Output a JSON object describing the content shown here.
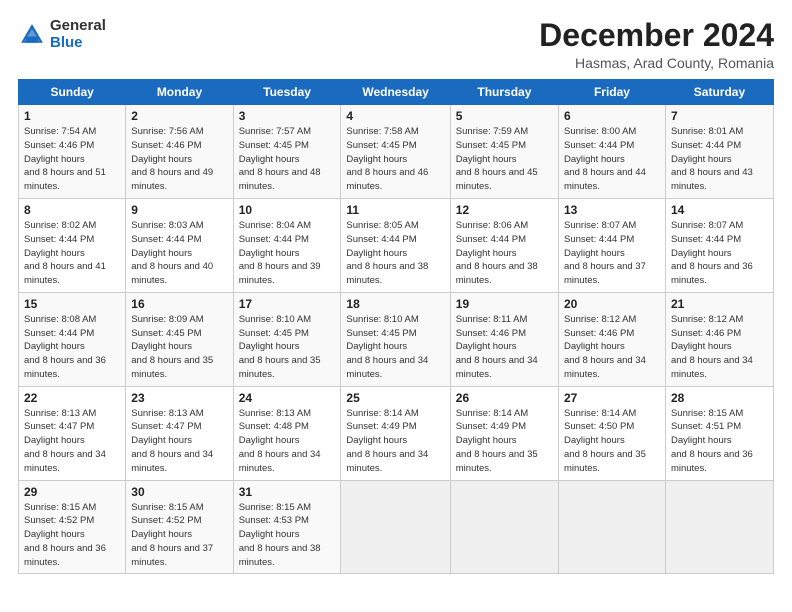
{
  "header": {
    "logo_general": "General",
    "logo_blue": "Blue",
    "title": "December 2024",
    "subtitle": "Hasmas, Arad County, Romania"
  },
  "days_of_week": [
    "Sunday",
    "Monday",
    "Tuesday",
    "Wednesday",
    "Thursday",
    "Friday",
    "Saturday"
  ],
  "weeks": [
    [
      {
        "num": "1",
        "rise": "7:54 AM",
        "set": "4:46 PM",
        "daylight": "8 hours and 51 minutes."
      },
      {
        "num": "2",
        "rise": "7:56 AM",
        "set": "4:46 PM",
        "daylight": "8 hours and 49 minutes."
      },
      {
        "num": "3",
        "rise": "7:57 AM",
        "set": "4:45 PM",
        "daylight": "8 hours and 48 minutes."
      },
      {
        "num": "4",
        "rise": "7:58 AM",
        "set": "4:45 PM",
        "daylight": "8 hours and 46 minutes."
      },
      {
        "num": "5",
        "rise": "7:59 AM",
        "set": "4:45 PM",
        "daylight": "8 hours and 45 minutes."
      },
      {
        "num": "6",
        "rise": "8:00 AM",
        "set": "4:44 PM",
        "daylight": "8 hours and 44 minutes."
      },
      {
        "num": "7",
        "rise": "8:01 AM",
        "set": "4:44 PM",
        "daylight": "8 hours and 43 minutes."
      }
    ],
    [
      {
        "num": "8",
        "rise": "8:02 AM",
        "set": "4:44 PM",
        "daylight": "8 hours and 41 minutes."
      },
      {
        "num": "9",
        "rise": "8:03 AM",
        "set": "4:44 PM",
        "daylight": "8 hours and 40 minutes."
      },
      {
        "num": "10",
        "rise": "8:04 AM",
        "set": "4:44 PM",
        "daylight": "8 hours and 39 minutes."
      },
      {
        "num": "11",
        "rise": "8:05 AM",
        "set": "4:44 PM",
        "daylight": "8 hours and 38 minutes."
      },
      {
        "num": "12",
        "rise": "8:06 AM",
        "set": "4:44 PM",
        "daylight": "8 hours and 38 minutes."
      },
      {
        "num": "13",
        "rise": "8:07 AM",
        "set": "4:44 PM",
        "daylight": "8 hours and 37 minutes."
      },
      {
        "num": "14",
        "rise": "8:07 AM",
        "set": "4:44 PM",
        "daylight": "8 hours and 36 minutes."
      }
    ],
    [
      {
        "num": "15",
        "rise": "8:08 AM",
        "set": "4:44 PM",
        "daylight": "8 hours and 36 minutes."
      },
      {
        "num": "16",
        "rise": "8:09 AM",
        "set": "4:45 PM",
        "daylight": "8 hours and 35 minutes."
      },
      {
        "num": "17",
        "rise": "8:10 AM",
        "set": "4:45 PM",
        "daylight": "8 hours and 35 minutes."
      },
      {
        "num": "18",
        "rise": "8:10 AM",
        "set": "4:45 PM",
        "daylight": "8 hours and 34 minutes."
      },
      {
        "num": "19",
        "rise": "8:11 AM",
        "set": "4:46 PM",
        "daylight": "8 hours and 34 minutes."
      },
      {
        "num": "20",
        "rise": "8:12 AM",
        "set": "4:46 PM",
        "daylight": "8 hours and 34 minutes."
      },
      {
        "num": "21",
        "rise": "8:12 AM",
        "set": "4:46 PM",
        "daylight": "8 hours and 34 minutes."
      }
    ],
    [
      {
        "num": "22",
        "rise": "8:13 AM",
        "set": "4:47 PM",
        "daylight": "8 hours and 34 minutes."
      },
      {
        "num": "23",
        "rise": "8:13 AM",
        "set": "4:47 PM",
        "daylight": "8 hours and 34 minutes."
      },
      {
        "num": "24",
        "rise": "8:13 AM",
        "set": "4:48 PM",
        "daylight": "8 hours and 34 minutes."
      },
      {
        "num": "25",
        "rise": "8:14 AM",
        "set": "4:49 PM",
        "daylight": "8 hours and 34 minutes."
      },
      {
        "num": "26",
        "rise": "8:14 AM",
        "set": "4:49 PM",
        "daylight": "8 hours and 35 minutes."
      },
      {
        "num": "27",
        "rise": "8:14 AM",
        "set": "4:50 PM",
        "daylight": "8 hours and 35 minutes."
      },
      {
        "num": "28",
        "rise": "8:15 AM",
        "set": "4:51 PM",
        "daylight": "8 hours and 36 minutes."
      }
    ],
    [
      {
        "num": "29",
        "rise": "8:15 AM",
        "set": "4:52 PM",
        "daylight": "8 hours and 36 minutes."
      },
      {
        "num": "30",
        "rise": "8:15 AM",
        "set": "4:52 PM",
        "daylight": "8 hours and 37 minutes."
      },
      {
        "num": "31",
        "rise": "8:15 AM",
        "set": "4:53 PM",
        "daylight": "8 hours and 38 minutes."
      },
      null,
      null,
      null,
      null
    ]
  ]
}
